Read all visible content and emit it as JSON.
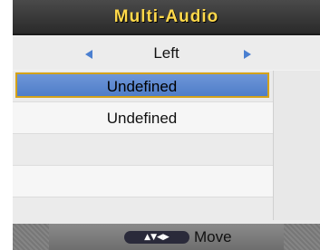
{
  "title": "Multi-Audio",
  "selector": {
    "value": "Left",
    "left_icon": "triangle-left-icon",
    "right_icon": "triangle-right-icon"
  },
  "list": {
    "items": [
      {
        "label": "Undefined",
        "selected": true
      },
      {
        "label": "Undefined",
        "selected": false
      },
      {
        "label": "",
        "selected": false
      },
      {
        "label": "",
        "selected": false
      },
      {
        "label": "",
        "selected": false
      }
    ]
  },
  "footer": {
    "nav_glyphs": "▲▼◀▶",
    "label": "Move"
  },
  "colors": {
    "title_text": "#ffd84a",
    "highlight": "#5a86cc",
    "highlight_border": "#d4a21a",
    "arrow": "#4a7fd0"
  }
}
